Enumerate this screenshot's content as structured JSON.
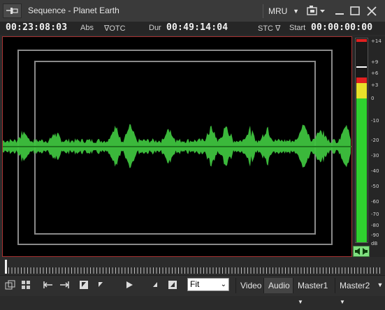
{
  "window": {
    "title": "Sequence - Planet Earth",
    "mru_label": "MRU"
  },
  "timecode": {
    "position": "00:23:08:03",
    "position_mode": "Abs",
    "otc_label": "∇OTC",
    "dur_label": "Dur",
    "duration": "00:49:14:04",
    "stc_label": "STC ∇",
    "start_label": "Start",
    "start": "00:00:00:00"
  },
  "meter": {
    "labels": [
      "+14",
      "+9",
      "+6",
      "+3",
      "0",
      "-10",
      "-20",
      "-30",
      "-40",
      "-50",
      "-60",
      "-70",
      "-80",
      "-90",
      "dB"
    ],
    "level_db": 3,
    "peak_db": 7,
    "colors": {
      "green": "#2fd12f",
      "yellow": "#e8e02a",
      "red": "#e12020"
    }
  },
  "toolbar": {
    "zoom_value": "Fit",
    "tabs": [
      "Video",
      "Audio",
      "Master1",
      "Master2"
    ],
    "active_tab": "Audio"
  },
  "colors": {
    "waveform": "#3ec23e",
    "viewer_border": "#a83232",
    "safe_area": "#8a8a8a"
  }
}
